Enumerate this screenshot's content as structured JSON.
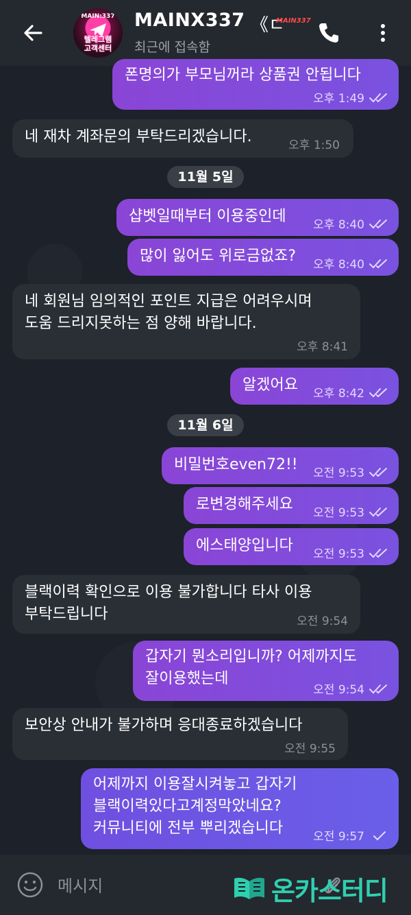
{
  "header": {
    "title": "MAINX337",
    "title_deco": "《ㄷ",
    "title_badge": "MAIN337",
    "status": "최근에 접속함",
    "avatar": {
      "top": "MAIN:337",
      "line1": "텔레그램",
      "line2": "고객센터"
    }
  },
  "dates": {
    "nov5": "11월 5일",
    "nov6": "11월 6일"
  },
  "messages": [
    {
      "dir": "out",
      "text": "폰명의가 부모님꺼라 상품권 안됩니다",
      "time": "오후 1:49",
      "read": true
    },
    {
      "dir": "in",
      "text": "네 재차 계좌문의 부탁드리겠습니다.",
      "time": "오후 1:50"
    },
    {
      "dir": "out",
      "text": "샵벳일때부터 이용중인데",
      "time": "오후 8:40",
      "read": true
    },
    {
      "dir": "out",
      "text": "많이 잃어도 위로금없죠?",
      "time": "오후 8:40",
      "read": true
    },
    {
      "dir": "in",
      "text": "네 회원님 임의적인 포인트 지급은 어려우시며\n도움 드리지못하는 점 양해 바랍니다.",
      "time": "오후 8:41"
    },
    {
      "dir": "out",
      "text": "알겠어요",
      "time": "오후 8:42",
      "read": true
    },
    {
      "dir": "out",
      "text": "비밀번호even72!!",
      "time": "오전 9:53",
      "read": true
    },
    {
      "dir": "out",
      "text": "로변경해주세요",
      "time": "오전 9:53",
      "read": true
    },
    {
      "dir": "out",
      "text": "에스태양입니다",
      "time": "오전 9:53",
      "read": true
    },
    {
      "dir": "in",
      "text": "블랙이력 확인으로 이용 불가합니다 타사 이용\n부탁드립니다",
      "time": "오전 9:54"
    },
    {
      "dir": "out",
      "text": "갑자기 뭔소리입니까? 어제까지도\n잘이용했는데",
      "time": "오전 9:54",
      "read": true
    },
    {
      "dir": "in",
      "text": "보안상 안내가 불가하며 응대종료하겠습니다",
      "time": "오전 9:55"
    },
    {
      "dir": "out",
      "text": "어제까지 이용잘시켜놓고 갑자기\n블랙이력있다고계정막았네요?\n커뮤니티에 전부 뿌리겠습니다",
      "time": "오전 9:57",
      "read": false
    }
  ],
  "input": {
    "placeholder": "메시지"
  },
  "watermark": "온카스터디",
  "colors": {
    "outgoing": "#8a45d6",
    "incoming": "#2a2f36",
    "header": "#24282f",
    "watermark": "#2fd0b0"
  },
  "icons": [
    "back-arrow-icon",
    "phone-icon",
    "more-vert-icon",
    "emoji-icon",
    "attach-icon",
    "double-check-icon",
    "single-check-icon"
  ]
}
